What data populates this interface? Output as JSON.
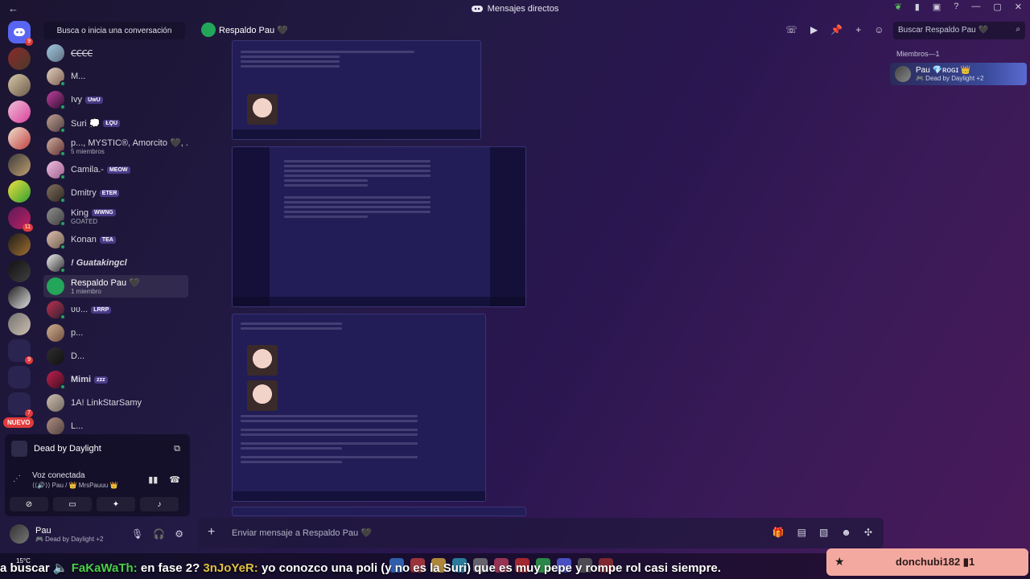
{
  "window": {
    "title": "Mensajes directos",
    "back_glyph": "←",
    "controls": [
      "—",
      "▢",
      "✕"
    ]
  },
  "rail": {
    "home_badge": "9",
    "badges": [
      "11",
      "9",
      "7"
    ],
    "new_label": "NUEVO"
  },
  "dm": {
    "search_placeholder": "Busca o inicia una conversación",
    "items": [
      {
        "name": "ꞒꞒꞒꞒ",
        "tag": "",
        "sub": ""
      },
      {
        "name": "M...",
        "tag": "",
        "sub": ""
      },
      {
        "name": "Ivy",
        "tag": "UwU",
        "sub": ""
      },
      {
        "name": "Suri 💭",
        "tag": "ŁϘU",
        "sub": ""
      },
      {
        "name": "p..., MYSTIC®, Amorcito 🖤, ...",
        "tag": "",
        "sub": "5 miembros"
      },
      {
        "name": "Camila.-",
        "tag": "MEOW",
        "sub": ""
      },
      {
        "name": "Dmitry",
        "tag": "ETER",
        "sub": ""
      },
      {
        "name": "King",
        "tag": "WWNG",
        "sub": "GOATED"
      },
      {
        "name": "Konan",
        "tag": "TEA",
        "sub": ""
      },
      {
        "name": "! Guatakingcl",
        "tag": "",
        "sub": ""
      },
      {
        "name": "Respaldo Pau 🖤",
        "tag": "",
        "sub": "1 miembro"
      },
      {
        "name": "ʋʋ...",
        "tag": "LRRP",
        "sub": ""
      },
      {
        "name": "p...",
        "tag": "",
        "sub": ""
      },
      {
        "name": "D...",
        "tag": "",
        "sub": ""
      },
      {
        "name": "Mimi",
        "tag": "zzz",
        "sub": ""
      },
      {
        "name": "1A! LinkStarSamy",
        "tag": "",
        "sub": ""
      },
      {
        "name": "L...",
        "tag": "",
        "sub": ""
      }
    ]
  },
  "voice": {
    "game": "Dead by Daylight",
    "status": "Voz conectada",
    "channel": "⟨⟨🔊⟩⟩ Pau / 👑 MrsPauuu 👑"
  },
  "user": {
    "name": "Pau",
    "activity": "🎮 Dead by Daylight +2"
  },
  "channel": {
    "name": "Respaldo Pau 🖤",
    "search_placeholder": "Buscar Respaldo Pau 🖤"
  },
  "members": {
    "header": "Miembros—1",
    "list": [
      {
        "name": "Pau 💎ʀᴏɢɪ 👑",
        "activity": "🎮 Dead by Daylight +2"
      }
    ]
  },
  "composer": {
    "placeholder": "Enviar mensaje a Respaldo Pau 🖤"
  },
  "overlay": {
    "weather": "15°C",
    "ticker_lead": "a buscar",
    "ticker_user1": "FaKaWaTh:",
    "ticker_text1": "en fase 2?",
    "ticker_user2": "3nJoYeR:",
    "ticker_text2": "yo conozco una poli (y no es la Suri) que es muy pepe y rompe rol casi siempre.",
    "follower": "donchubi182 ▮1"
  },
  "colors": {
    "online": "#23a55a",
    "accent": "#5865f2",
    "badge": "#e03b3b",
    "follow_bg": "#f4a9a0"
  }
}
